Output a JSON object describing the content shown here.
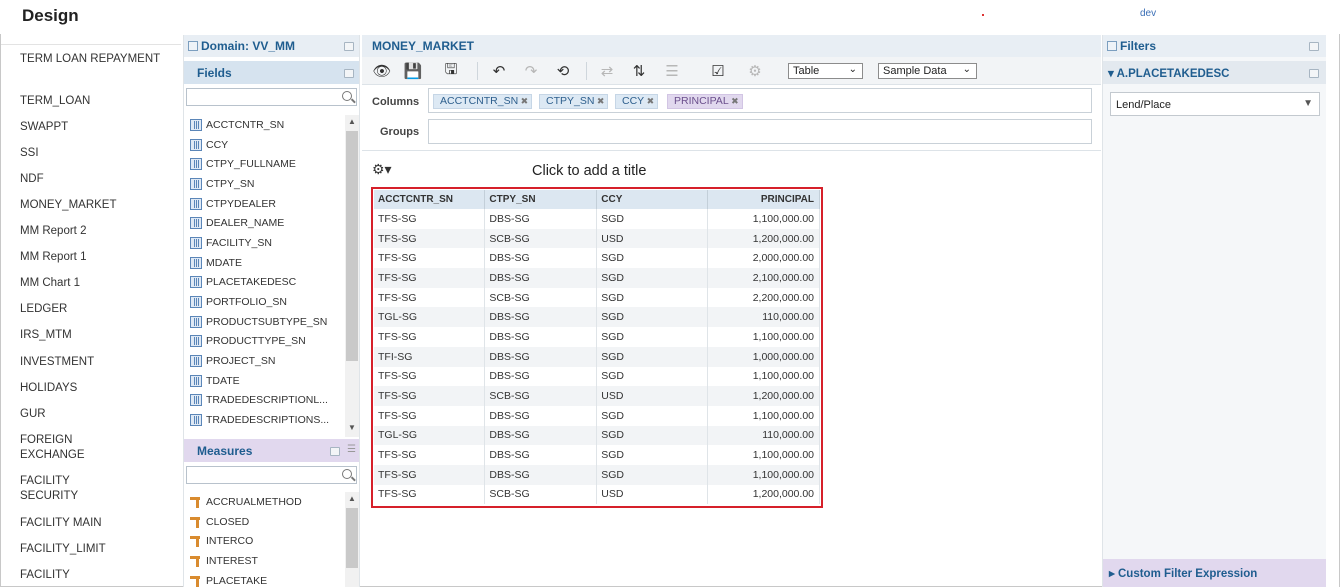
{
  "header": {
    "app_title": "Design",
    "user": "dev"
  },
  "reports": [
    "TERM LOAN REPAYMENT",
    "TERM_LOAN",
    "SWAPPT",
    "SSI",
    "NDF",
    "MONEY_MARKET",
    "MM Report 2",
    "MM Report 1",
    "MM Chart 1",
    "LEDGER",
    "IRS_MTM",
    "INVESTMENT",
    "HOLIDAYS",
    "GUR",
    "FOREIGN EXCHANGE",
    "FACILITY SECURITY",
    "FACILITY MAIN",
    "FACILITY_LIMIT",
    "FACILITY"
  ],
  "domain_panel": {
    "title": "Domain: VV_MM"
  },
  "fields_panel": {
    "title": "Fields",
    "items": [
      "ACCTCNTR_SN",
      "CCY",
      "CTPY_FULLNAME",
      "CTPY_SN",
      "CTPYDEALER",
      "DEALER_NAME",
      "FACILITY_SN",
      "MDATE",
      "PLACETAKEDESC",
      "PORTFOLIO_SN",
      "PRODUCTSUBTYPE_SN",
      "PRODUCTTYPE_SN",
      "PROJECT_SN",
      "TDATE",
      "TRADEDESCRIPTIONL...",
      "TRADEDESCRIPTIONS..."
    ]
  },
  "measures_panel": {
    "title": "Measures",
    "items": [
      "ACCRUALMETHOD",
      "CLOSED",
      "INTERCO",
      "INTEREST",
      "PLACETAKE"
    ]
  },
  "main": {
    "title": "MONEY_MARKET",
    "view_type": "Table",
    "data_mode": "Sample Data",
    "columns_label": "Columns",
    "groups_label": "Groups",
    "column_chips": [
      {
        "label": "ACCTCNTR_SN",
        "kind": "field"
      },
      {
        "label": "CTPY_SN",
        "kind": "field"
      },
      {
        "label": "CCY",
        "kind": "field"
      },
      {
        "label": "PRINCIPAL",
        "kind": "measure"
      }
    ],
    "title_placeholder": "Click to add a title"
  },
  "table": {
    "headers": [
      "ACCTCNTR_SN",
      "CTPY_SN",
      "CCY",
      "PRINCIPAL"
    ],
    "rows": [
      [
        "TFS-SG",
        "DBS-SG",
        "SGD",
        "1,100,000.00"
      ],
      [
        "TFS-SG",
        "SCB-SG",
        "USD",
        "1,200,000.00"
      ],
      [
        "TFS-SG",
        "DBS-SG",
        "SGD",
        "2,000,000.00"
      ],
      [
        "TFS-SG",
        "DBS-SG",
        "SGD",
        "2,100,000.00"
      ],
      [
        "TFS-SG",
        "SCB-SG",
        "SGD",
        "2,200,000.00"
      ],
      [
        "TGL-SG",
        "DBS-SG",
        "SGD",
        "110,000.00"
      ],
      [
        "TFS-SG",
        "DBS-SG",
        "SGD",
        "1,100,000.00"
      ],
      [
        "TFI-SG",
        "DBS-SG",
        "SGD",
        "1,000,000.00"
      ],
      [
        "TFS-SG",
        "DBS-SG",
        "SGD",
        "1,100,000.00"
      ],
      [
        "TFS-SG",
        "SCB-SG",
        "USD",
        "1,200,000.00"
      ],
      [
        "TFS-SG",
        "DBS-SG",
        "SGD",
        "1,100,000.00"
      ],
      [
        "TGL-SG",
        "DBS-SG",
        "SGD",
        "110,000.00"
      ],
      [
        "TFS-SG",
        "DBS-SG",
        "SGD",
        "1,100,000.00"
      ],
      [
        "TFS-SG",
        "DBS-SG",
        "SGD",
        "1,100,000.00"
      ],
      [
        "TFS-SG",
        "SCB-SG",
        "USD",
        "1,200,000.00"
      ]
    ]
  },
  "filters_panel": {
    "title": "Filters",
    "filter_name": "A.PLACETAKEDESC",
    "filter_value": "Lend/Place",
    "custom_label": "Custom Filter Expression"
  },
  "colors": {
    "accent": "#1f5d8f",
    "highlight": "#d6202a",
    "measure": "#e1d8ee"
  }
}
